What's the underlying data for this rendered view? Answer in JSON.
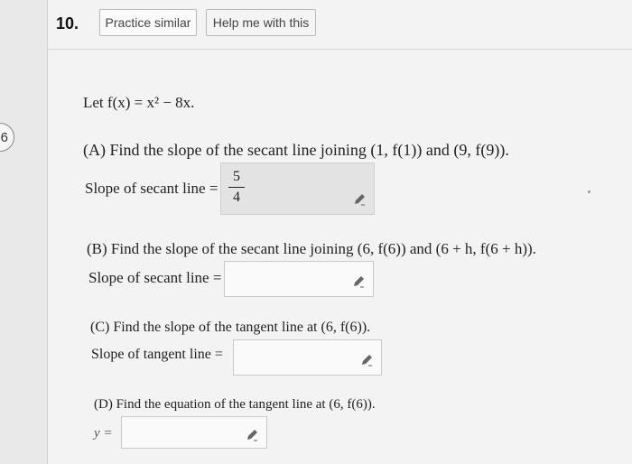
{
  "question": {
    "number": "10.",
    "badge": "6",
    "practice_label": "Practice similar",
    "help_label": "Help me with this",
    "function_def": "Let f(x) = x² − 8x."
  },
  "parts": {
    "a": {
      "prompt": "(A) Find the slope of the secant line joining (1, f(1)) and (9, f(9)).",
      "label": "Slope of secant line =",
      "answer_numerator": "5",
      "answer_denominator": "4"
    },
    "b": {
      "prompt": "(B) Find the slope of the secant line joining (6, f(6)) and (6 + h, f(6 + h)).",
      "label": "Slope of secant line =",
      "answer": ""
    },
    "c": {
      "prompt": "(C) Find the slope of the tangent line at (6, f(6)).",
      "label": "Slope of tangent line =",
      "answer": ""
    },
    "d": {
      "prompt": "(D) Find the equation of the tangent line at (6, f(6)).",
      "label": "y =",
      "answer": ""
    }
  },
  "icons": {
    "edit": "pencil-icon"
  },
  "colors": {
    "page_bg": "#f3f3f3",
    "filled_answer_bg": "#e3e3e3",
    "empty_answer_bg": "#fafafa"
  }
}
